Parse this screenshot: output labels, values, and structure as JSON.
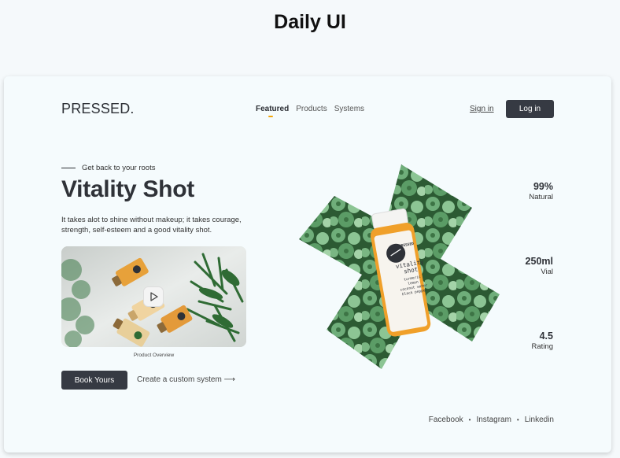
{
  "header": {
    "title": "Daily UI"
  },
  "site": {
    "logo": "PRESSED.",
    "nav": [
      {
        "label": "Featured",
        "active": true
      },
      {
        "label": "Products",
        "active": false
      },
      {
        "label": "Systems",
        "active": false
      }
    ],
    "sign_in_label": "Sign in",
    "log_in_label": "Log in"
  },
  "hero": {
    "tagline": "Get back to your roots",
    "title": "Vitality Shot",
    "description": "It takes alot to shine without makeup; it takes courage, strength, self-esteem and a good vitality shot.",
    "video_caption": "Product Overview",
    "primary_cta": "Book Yours",
    "secondary_cta": "Create a custom system ⟶"
  },
  "product_bottle": {
    "brand": "PRESSED",
    "name_line1": "vitality",
    "name_line2": "shot",
    "ingredients": [
      "turmeric",
      "lemon",
      "coconut water",
      "black pepper"
    ]
  },
  "stats": [
    {
      "value": "99%",
      "label": "Natural"
    },
    {
      "value": "250ml",
      "label": "Vial"
    },
    {
      "value": "4.5",
      "label": "Rating"
    }
  ],
  "social": [
    "Facebook",
    "Instagram",
    "Linkedin"
  ],
  "colors": {
    "accent": "#f2a60a",
    "button_dark": "#363a43",
    "juice_orange": "#f0a02a",
    "leaf_green": "#5aa66a"
  }
}
